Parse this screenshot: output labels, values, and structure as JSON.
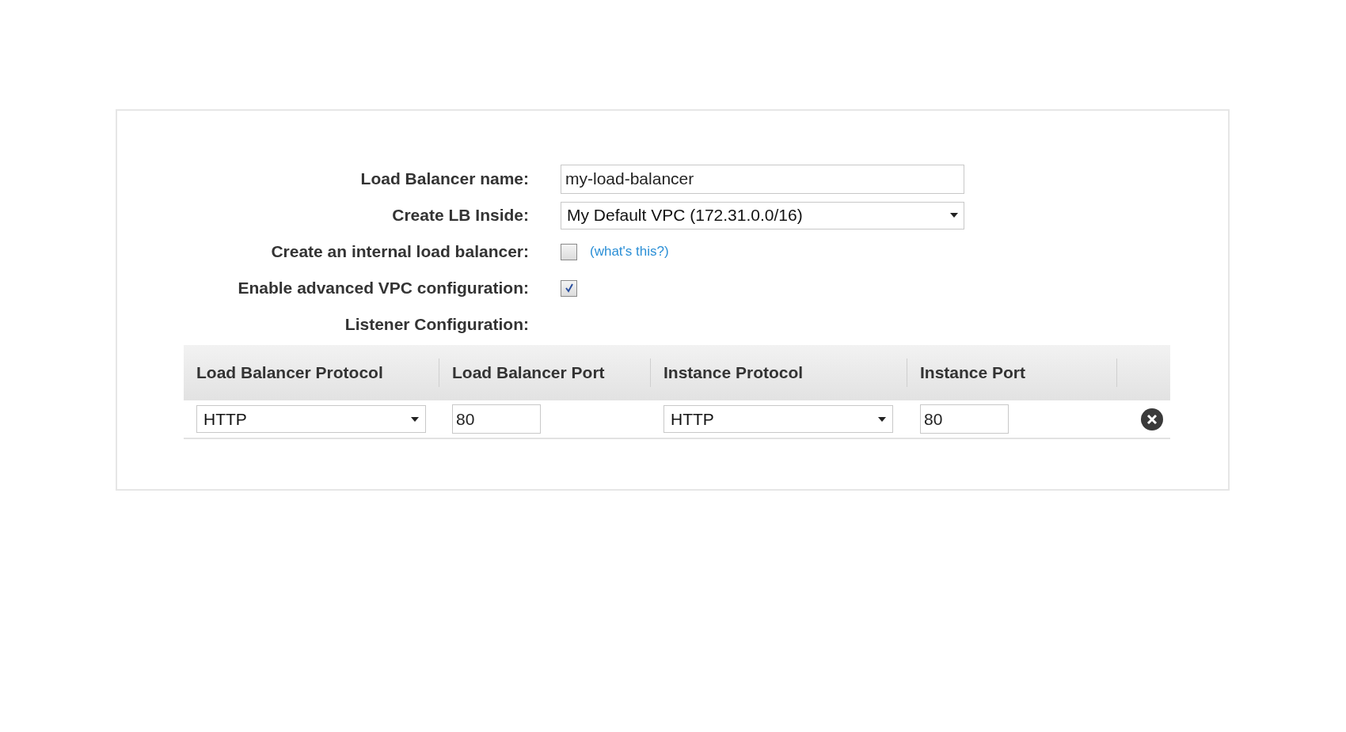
{
  "form": {
    "fields": [
      {
        "kind": "text",
        "label": "Load Balancer name:",
        "value": "my-load-balancer"
      },
      {
        "kind": "select",
        "label": "Create LB Inside:",
        "value": "My Default VPC (172.31.0.0/16)"
      },
      {
        "kind": "checkbox",
        "label": "Create an internal load balancer:",
        "checked": false,
        "link": "(what's this?)"
      },
      {
        "kind": "checkbox",
        "label": "Enable advanced VPC configuration:",
        "checked": true
      },
      {
        "kind": "heading",
        "label": "Listener Configuration:"
      }
    ]
  },
  "listeners": {
    "columns": [
      "Load Balancer Protocol",
      "Load Balancer Port",
      "Instance Protocol",
      "Instance Port"
    ],
    "rows": [
      {
        "cells": [
          {
            "kind": "select",
            "value": "HTTP"
          },
          {
            "kind": "text",
            "value": "80"
          },
          {
            "kind": "select",
            "value": "HTTP"
          },
          {
            "kind": "text",
            "value": "80"
          }
        ]
      }
    ]
  }
}
